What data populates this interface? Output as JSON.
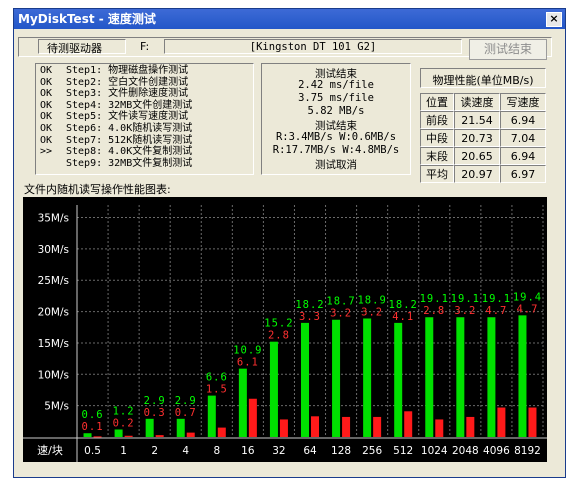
{
  "window": {
    "title": "MyDiskTest - 速度测试",
    "close_glyph": "×"
  },
  "header": {
    "drive_label": "待测驱动器",
    "drive_letter": "F:",
    "device_name": "[Kingston DT 101 G2]",
    "end_button": "测试结束"
  },
  "steps": [
    {
      "status": "OK",
      "text": "Step1: 物理磁盘操作测试"
    },
    {
      "status": "OK",
      "text": "Step2: 空白文件创建测试"
    },
    {
      "status": "OK",
      "text": "Step3: 文件删除速度测试"
    },
    {
      "status": "OK",
      "text": "Step4: 32MB文件创建测试"
    },
    {
      "status": "OK",
      "text": "Step5: 文件读写速度测试"
    },
    {
      "status": "OK",
      "text": "Step6: 4.0K随机读写测试"
    },
    {
      "status": "OK",
      "text": "Step7: 512K随机读写测试"
    },
    {
      "status": ">>",
      "text": "Step8: 4.0K文件复制测试"
    },
    {
      "status": "",
      "text": "Step9: 32MB文件复制测试"
    }
  ],
  "results": [
    "测试结束",
    "2.42 ms/file",
    "3.75 ms/file",
    "5.82 MB/s",
    "测试结束",
    "R:3.4MB/s W:0.6MB/s",
    "R:17.7MB/s W:4.8MB/s",
    "测试取消"
  ],
  "performance": {
    "title": "物理性能(单位MB/s)",
    "headers": [
      "位置",
      "读速度",
      "写速度"
    ],
    "rows": [
      [
        "前段",
        "21.54",
        "6.94"
      ],
      [
        "中段",
        "20.73",
        "7.04"
      ],
      [
        "末段",
        "20.65",
        "6.94"
      ],
      [
        "平均",
        "20.97",
        "6.97"
      ]
    ]
  },
  "chart_title": "文件内随机读写操作性能图表:",
  "chart_data": {
    "type": "bar",
    "xlabel": "速/块",
    "categories": [
      "0.5",
      "1",
      "2",
      "4",
      "8",
      "16",
      "32",
      "64",
      "128",
      "256",
      "512",
      "1024",
      "2048",
      "4096",
      "8192"
    ],
    "ylim": [
      0,
      37
    ],
    "yticks": [
      "5M/s",
      "10M/s",
      "15M/s",
      "20M/s",
      "25M/s",
      "30M/s",
      "35M/s"
    ],
    "ytick_values": [
      5,
      10,
      15,
      20,
      25,
      30,
      35
    ],
    "series": [
      {
        "values": [
          0.6,
          1.2,
          2.9,
          2.9,
          6.6,
          10.9,
          15.2,
          18.2,
          18.7,
          18.9,
          18.2,
          19.1,
          19.1,
          19.1,
          19.4
        ],
        "color": "#00e000",
        "label_color": "#00ff00"
      },
      {
        "values": [
          0.1,
          0.2,
          0.3,
          0.7,
          1.5,
          6.1,
          2.8,
          3.3,
          3.2,
          3.2,
          4.1,
          2.8,
          3.2,
          4.7,
          4.7
        ],
        "color": "#ff1a1a",
        "label_color": "#ff3030"
      }
    ],
    "grid": true
  }
}
